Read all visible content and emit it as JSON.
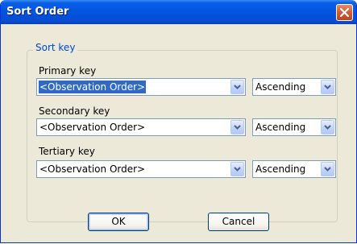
{
  "window": {
    "title": "Sort Order"
  },
  "group": {
    "title": "Sort key"
  },
  "keys": [
    {
      "label": "Primary key",
      "field": "<Observation Order>",
      "order": "Ascending"
    },
    {
      "label": "Secondary key",
      "field": "<Observation Order>",
      "order": "Ascending"
    },
    {
      "label": "Tertiary key",
      "field": "<Observation Order>",
      "order": "Ascending"
    }
  ],
  "buttons": {
    "ok": "OK",
    "cancel": "Cancel"
  },
  "icons": {
    "close": "close-icon",
    "dropdown": "chevron-down-icon"
  },
  "colors": {
    "titlebar": "#0355e0",
    "selection": "#316ac5",
    "group_title": "#0046d5"
  }
}
